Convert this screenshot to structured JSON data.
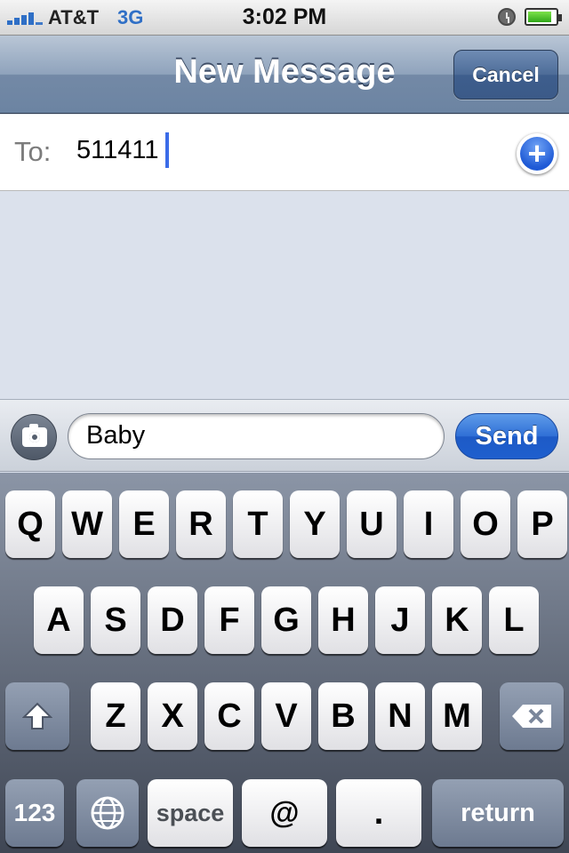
{
  "status_bar": {
    "carrier": "AT&T",
    "network": "3G",
    "time": "3:02 PM",
    "battery_level": 0.85,
    "signal_bars": 4
  },
  "nav": {
    "title": "New Message",
    "cancel_label": "Cancel"
  },
  "to_field": {
    "label": "To:",
    "value": "511411"
  },
  "compose": {
    "message_text": "Baby",
    "send_label": "Send"
  },
  "keyboard": {
    "row1": [
      "Q",
      "W",
      "E",
      "R",
      "T",
      "Y",
      "U",
      "I",
      "O",
      "P"
    ],
    "row2": [
      "A",
      "S",
      "D",
      "F",
      "G",
      "H",
      "J",
      "K",
      "L"
    ],
    "row3": [
      "Z",
      "X",
      "C",
      "V",
      "B",
      "N",
      "M"
    ],
    "numbers_label": "123",
    "space_label": "space",
    "at_label": "@",
    "period_label": ".",
    "return_label": "return"
  },
  "colors": {
    "accent_blue": "#2f6fd6",
    "nav_blue": "#6c84a2",
    "background": "#dbe1ec"
  }
}
